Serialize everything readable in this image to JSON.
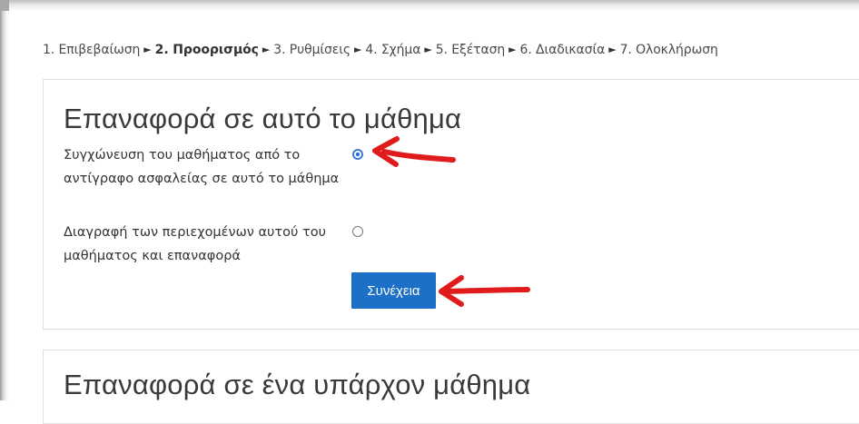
{
  "wizard": {
    "steps": [
      {
        "label": "1. Επιβεβαίωση",
        "current": false
      },
      {
        "label": "2. Προορισμός",
        "current": true
      },
      {
        "label": "3. Ρυθμίσεις",
        "current": false
      },
      {
        "label": "4. Σχήμα",
        "current": false
      },
      {
        "label": "5. Εξέταση",
        "current": false
      },
      {
        "label": "6. Διαδικασία",
        "current": false
      },
      {
        "label": "7. Ολοκλήρωση",
        "current": false
      }
    ],
    "separator_glyph": "►"
  },
  "restore_this_course": {
    "title": "Επαναφορά σε αυτό το μάθημα",
    "options": [
      {
        "label": "Συγχώνευση του μαθήματος από το αντίγραφο ασφαλείας σε αυτό το μάθημα",
        "checked": true
      },
      {
        "label": "Διαγραφή των περιεχομένων αυτού του μαθήματος και επαναφορά",
        "checked": false
      }
    ],
    "continue_label": "Συνέχεια"
  },
  "restore_existing_course": {
    "title": "Επαναφορά σε ένα υπάρχον μάθημα"
  },
  "colors": {
    "button": "#1d70c8",
    "annotation_arrow": "#e01b1b"
  }
}
